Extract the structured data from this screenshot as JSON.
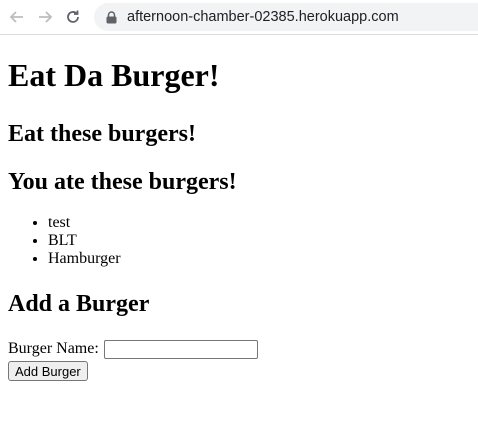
{
  "browser": {
    "url": "afternoon-chamber-02385.herokuapp.com",
    "icons": {
      "back": "back-arrow-icon",
      "forward": "forward-arrow-icon",
      "reload": "reload-icon",
      "lock": "lock-icon"
    }
  },
  "page": {
    "title": "Eat Da Burger!",
    "eat_heading": "Eat these burgers!",
    "ate_heading": "You ate these burgers!",
    "eaten_items": [
      "test",
      "BLT",
      "Hamburger"
    ],
    "add_heading": "Add a Burger",
    "form": {
      "label": "Burger Name:",
      "input_value": "",
      "button_label": "Add Burger"
    }
  }
}
